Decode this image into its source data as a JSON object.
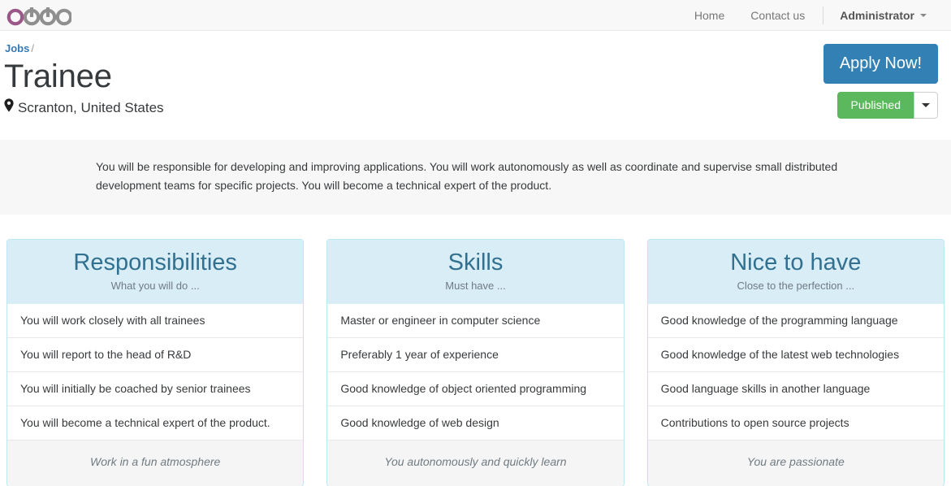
{
  "navbar": {
    "logo_text": "odoo",
    "logo_accent_color": "#9c5789",
    "logo_gray_color": "#8f8f8f",
    "links": [
      {
        "label": "Home",
        "name": "nav-link-home"
      },
      {
        "label": "Contact us",
        "name": "nav-link-contact-us"
      }
    ],
    "user": "Administrator"
  },
  "header": {
    "breadcrumb_parent": "Jobs",
    "breadcrumb_separator": "/",
    "title": "Trainee",
    "location": "Scranton, United States",
    "apply_button": "Apply Now!",
    "publish_state": "Published",
    "accent_blue": "#3380b5",
    "accent_green": "#5cb85c"
  },
  "description": {
    "text": "You will be responsible for developing and improving applications. You will work autonomously as well as coordinate and supervise small distributed development teams for specific projects. You will become a technical expert of the product."
  },
  "cards": [
    {
      "title": "Responsibilities",
      "subtitle": "What you will do ...",
      "items": [
        "You will work closely with all trainees",
        "You will report to the head of R&D",
        "You will initially be coached by senior trainees",
        "You will become a technical expert of the product."
      ],
      "footer": "Work in a fun atmosphere"
    },
    {
      "title": "Skills",
      "subtitle": "Must have ...",
      "items": [
        "Master or engineer in computer science",
        "Preferably 1 year of experience",
        "Good knowledge of object oriented programming",
        "Good knowledge of web design"
      ],
      "footer": "You autonomously and quickly learn"
    },
    {
      "title": "Nice to have",
      "subtitle": "Close to the perfection ...",
      "items": [
        "Good knowledge of the programming language",
        "Good knowledge of the latest web technologies",
        "Good language skills in another language",
        "Contributions to open source projects"
      ],
      "footer": "You are passionate"
    }
  ]
}
